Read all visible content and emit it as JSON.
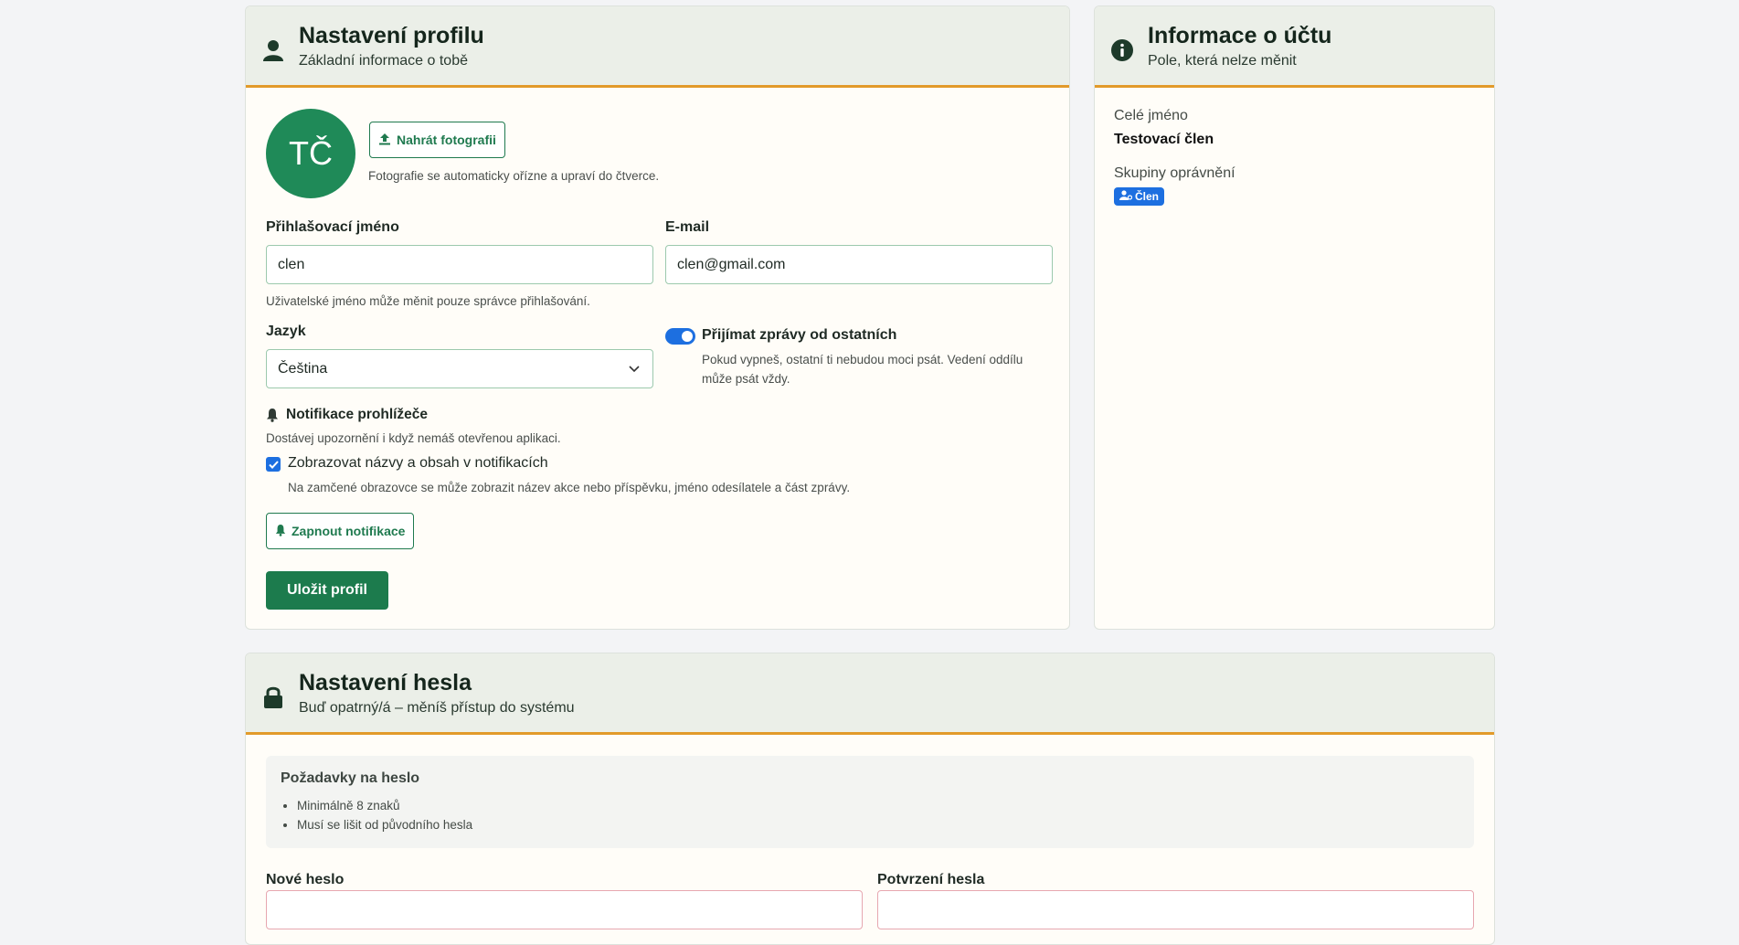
{
  "profile": {
    "title": "Nastavení profilu",
    "subtitle": "Základní informace o tobě",
    "avatar_initials": "TČ",
    "upload_button": "Nahrát fotografii",
    "upload_help": "Fotografie se automaticky ořízne a upraví do čtverce.",
    "username_label": "Přihlašovací jméno",
    "username_value": "clen",
    "username_help": "Uživatelské jméno může měnit pouze správce přihlašování.",
    "email_label": "E-mail",
    "email_value": "clen@gmail.com",
    "language_label": "Jazyk",
    "language_value": "Čeština",
    "messages_toggle_label": "Přijímat zprávy od ostatních",
    "messages_help_line1": "Pokud vypneš, ostatní ti nebudou moci psát. Vedení oddílu",
    "messages_help_line2": "může psát vždy.",
    "notifications_title": "Notifikace prohlížeče",
    "notifications_help": "Dostávej upozornění i když nemáš otevřenou aplikaci.",
    "show_content_label": "Zobrazovat názvy a obsah v notifikacích",
    "show_content_help": "Na zamčené obrazovce se může zobrazit název akce nebo příspěvku, jméno odesílatele a část zprávy.",
    "enable_notifications_button": "Zapnout notifikace",
    "save_button": "Uložit profil"
  },
  "account": {
    "title": "Informace o účtu",
    "subtitle": "Pole, která nelze měnit",
    "full_name_label": "Celé jméno",
    "full_name_value": "Testovací člen",
    "groups_label": "Skupiny oprávnění",
    "group_badge": "Člen"
  },
  "password": {
    "title": "Nastavení hesla",
    "subtitle": "Buď opatrný/á – měníš přístup do systému",
    "requirements_title": "Požadavky na heslo",
    "requirements": [
      "Minimálně 8 znaků",
      "Musí se lišit od původního hesla"
    ],
    "new_password_label": "Nové heslo",
    "confirm_password_label": "Potvrzení hesla"
  },
  "colors": {
    "accent_green": "#1c7b4d",
    "header_border": "#e29a2a",
    "toggle_blue": "#1d6fe0"
  }
}
